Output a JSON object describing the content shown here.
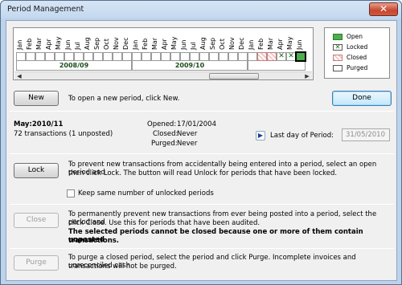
{
  "window": {
    "title": "Period Management",
    "close_glyph": "✕"
  },
  "timeline": {
    "months": [
      "Jan",
      "Feb",
      "Mar",
      "Apr",
      "May",
      "Jun",
      "Jul",
      "Aug",
      "Sep",
      "Oct",
      "Nov",
      "Dec",
      "Jan",
      "Feb",
      "Mar",
      "Apr",
      "May",
      "Jun",
      "Jul",
      "Aug",
      "Sep",
      "Oct",
      "Nov",
      "Dec",
      "Jan",
      "Feb",
      "Mar",
      "Apr",
      "May",
      "Jun"
    ],
    "years": [
      "2008/09",
      "2009/10"
    ],
    "current_period": "May"
  },
  "legend": {
    "open": "Open",
    "locked": "Locked",
    "closed": "Closed",
    "purged": "Purged",
    "locked_mark": "✕"
  },
  "new_section": {
    "button": "New",
    "description": "To open a new period, click New."
  },
  "done_button": "Done",
  "period": {
    "name": "May:2010/11",
    "transactions": "72 transactions (1 unposted)",
    "opened_label": "Opened:",
    "opened_value": "17/01/2004",
    "closed_label": "Closed:",
    "closed_value": "Never",
    "purged_label": "Purged:",
    "purged_value": "Never",
    "last_day_label": "Last day of Period:",
    "last_day_value": "31/05/2010"
  },
  "lock_section": {
    "button": "Lock",
    "description_1": "To prevent new transactions from accidentally being entered into a period, select an open period and",
    "description_2": "then click Lock. The button will read Unlock for periods that have been locked.",
    "checkbox_label": "Keep same number of unlocked periods"
  },
  "close_section": {
    "button": "Close",
    "description_1": "To permanently prevent new transactions from ever being posted into a period, select the period and",
    "description_2": "click Close. Use this for periods that have been audited.",
    "warning_1": "The selected periods cannot be closed because one or more of them contain unposted",
    "warning_2": "transactions."
  },
  "purge_section": {
    "button": "Purge",
    "description_1": "To purge a closed period, select the period and click Purge. Incomplete invoices and unreconciled cash",
    "description_2": "transactions will not be purged."
  },
  "colors": {
    "open": "#4cae4c",
    "locked": "#116b11",
    "closed": "#f3c6c6",
    "accent": "#3c7fb1"
  }
}
